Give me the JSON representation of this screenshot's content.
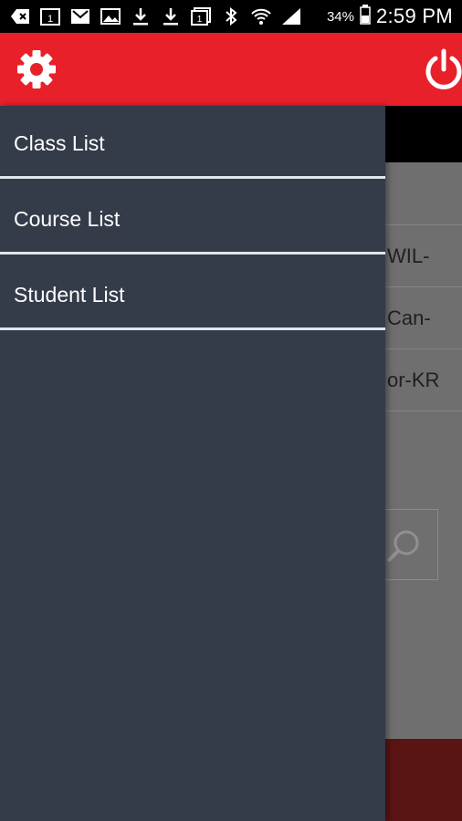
{
  "status_bar": {
    "icons": [
      "back-arrow-icon",
      "calendar-icon",
      "gmail-icon",
      "image-icon",
      "download-icon",
      "download-icon",
      "calendar-icon",
      "bluetooth-icon",
      "wifi-icon",
      "signal-icon"
    ],
    "battery": "34%",
    "time": "2:59 PM"
  },
  "app_bar": {
    "color": "#E8202A",
    "left_icon": "gear-icon",
    "right_icon": "power-icon"
  },
  "drawer": {
    "items": [
      {
        "label": "Class List"
      },
      {
        "label": "Course List"
      },
      {
        "label": "Student List"
      }
    ]
  },
  "background_list": {
    "rows": [
      "WIL-",
      "Can-",
      "or-KR"
    ]
  }
}
